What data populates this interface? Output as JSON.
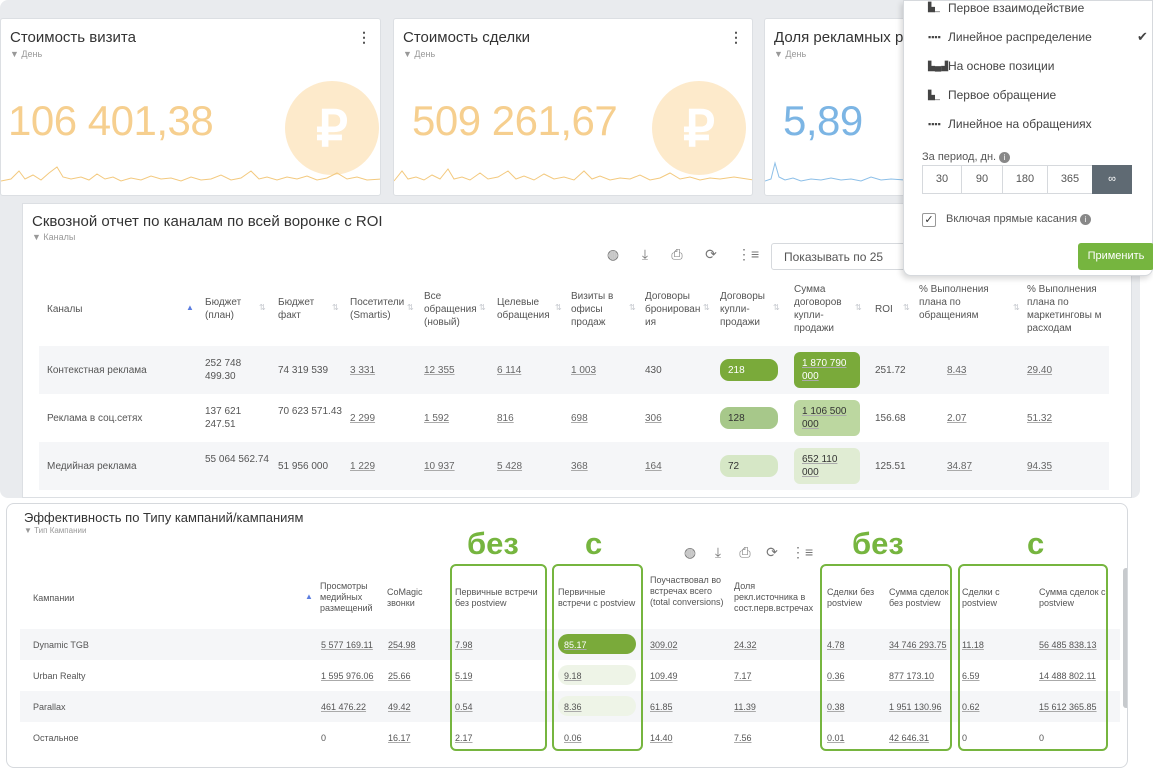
{
  "cards": [
    {
      "title": "Стоимость визита",
      "filter": "▼ День",
      "value": "106 401,38",
      "color": "#f6cf8f"
    },
    {
      "title": "Стоимость сделки",
      "filter": "▼ День",
      "value": "509 261,67",
      "color": "#f6cf8f"
    },
    {
      "title": "Доля рекламных ра",
      "filter": "▼ День",
      "value": "5,89",
      "color": "#7cb5e4"
    }
  ],
  "rub_symbol": "₽",
  "menu_glyph": "⋮",
  "report": {
    "title": "Сквозной отчет по каналам по всей воронке с ROI",
    "filter": "▼ Каналы",
    "show_label": "Показывать по 25",
    "columns": [
      "Каналы",
      "Бюджет (план)",
      "Бюджет факт",
      "Посетители (Smartis)",
      "Все обращения (новый)",
      "Целевые обращения",
      "Визиты в офисы продаж",
      "Договоры бронирован ия",
      "Договоры купли-продажи",
      "Сумма договоров купли-продажи",
      "ROI",
      "% Выполнения плана по обращениям",
      "% Выполнения плана по маркетинговы м расходам"
    ],
    "rows": [
      {
        "channel": "Контекстная реклама",
        "budget_plan": "252 748 499.30",
        "budget_fact": "74 319 539",
        "visitors": "3 331",
        "all_requests": "12 355",
        "target": "6 114",
        "visits": "1 003",
        "booking": "430",
        "deals": "218",
        "deals_sum": "1 870 790 000",
        "roi": "251.72",
        "plan_req": "8.43",
        "plan_mkt": "29.40"
      },
      {
        "channel": "Реклама в соц.сетях",
        "budget_plan": "137 621 247.51",
        "budget_fact": "70 623 571.43",
        "visitors": "2 299",
        "all_requests": "1 592",
        "target": "816",
        "visits": "698",
        "booking": "306",
        "deals": "128",
        "deals_sum": "1 106 500 000",
        "roi": "156.68",
        "plan_req": "2.07",
        "plan_mkt": "51.32"
      },
      {
        "channel": "Медийная реклама",
        "budget_plan": "55 064 562.74",
        "budget_fact": "51 956 000",
        "visitors": "1 229",
        "all_requests": "10 937",
        "target": "5 428",
        "visits": "368",
        "booking": "164",
        "deals": "72",
        "deals_sum": "652 110 000",
        "roi": "125.51",
        "plan_req": "34.87",
        "plan_mkt": "94.35"
      }
    ]
  },
  "dropdown": {
    "items": [
      {
        "icon": "first-touch-icon",
        "label": "Первое взаимодействие",
        "checked": false
      },
      {
        "icon": "linear-icon",
        "label": "Линейное распределение",
        "checked": true
      },
      {
        "icon": "position-based-icon",
        "label": "На основе позиции",
        "checked": false
      },
      {
        "icon": "first-request-icon",
        "label": "Первое обращение",
        "checked": false
      },
      {
        "icon": "linear-requests-icon",
        "label": "Линейное на обращениях",
        "checked": false
      }
    ],
    "period_label": "За период, дн.",
    "periods": [
      "30",
      "90",
      "180",
      "365",
      "∞"
    ],
    "active_period": "∞",
    "include_direct": "Включая прямые касания",
    "apply": "Применить"
  },
  "campaigns": {
    "title": "Эффективность по Типу кампаний/кампаниям",
    "filter": "▼ Тип Кампании",
    "labels": {
      "without": "без",
      "with": "с"
    },
    "columns": [
      "Кампании",
      "Просмотры медийных размещений",
      "CoMagic звонки",
      "Первичные встречи без postview",
      "Первичные встречи с postview",
      "Поучаствовал во встречах всего (total conversions)",
      "Доля рекл.источника в сост.перв.встречах",
      "Сделки без postview",
      "Сумма сделок без postview",
      "Сделки с postview",
      "Сумма сделок с postview"
    ],
    "rows": [
      {
        "name": "Dynamic TGB",
        "views": "5 577 169.11",
        "calls": "254.98",
        "meet_wo": "7.98",
        "meet_w": "85.17",
        "total": "309.02",
        "share": "24.32",
        "deals_wo": "4.78",
        "sum_wo": "34 746 293.75",
        "deals_w": "11.18",
        "sum_w": "56 485 838.13"
      },
      {
        "name": "Urban Realty",
        "views": "1 595 976.06",
        "calls": "25.66",
        "meet_wo": "5.19",
        "meet_w": "9.18",
        "total": "109.49",
        "share": "7.17",
        "deals_wo": "0.36",
        "sum_wo": "877 173.10",
        "deals_w": "6.59",
        "sum_w": "14 488 802.11"
      },
      {
        "name": "Parallax",
        "views": "461 476.22",
        "calls": "49.42",
        "meet_wo": "0.54",
        "meet_w": "8.36",
        "total": "61.85",
        "share": "11.39",
        "deals_wo": "0.38",
        "sum_wo": "1 951 130.96",
        "deals_w": "0.62",
        "sum_w": "15 612 365.85"
      },
      {
        "name": "Остальное",
        "views": "0",
        "calls": "16.17",
        "meet_wo": "2.17",
        "meet_w": "0.06",
        "total": "14.40",
        "share": "7.56",
        "deals_wo": "0.01",
        "sum_wo": "42 646.31",
        "deals_w": "0",
        "sum_w": "0"
      }
    ]
  },
  "colors": {
    "accent_green": "#76b53f",
    "pill_dark": "#7aaa3a",
    "pill_mid": "#bcd7a0",
    "pill_light": "#e0ecd3"
  }
}
